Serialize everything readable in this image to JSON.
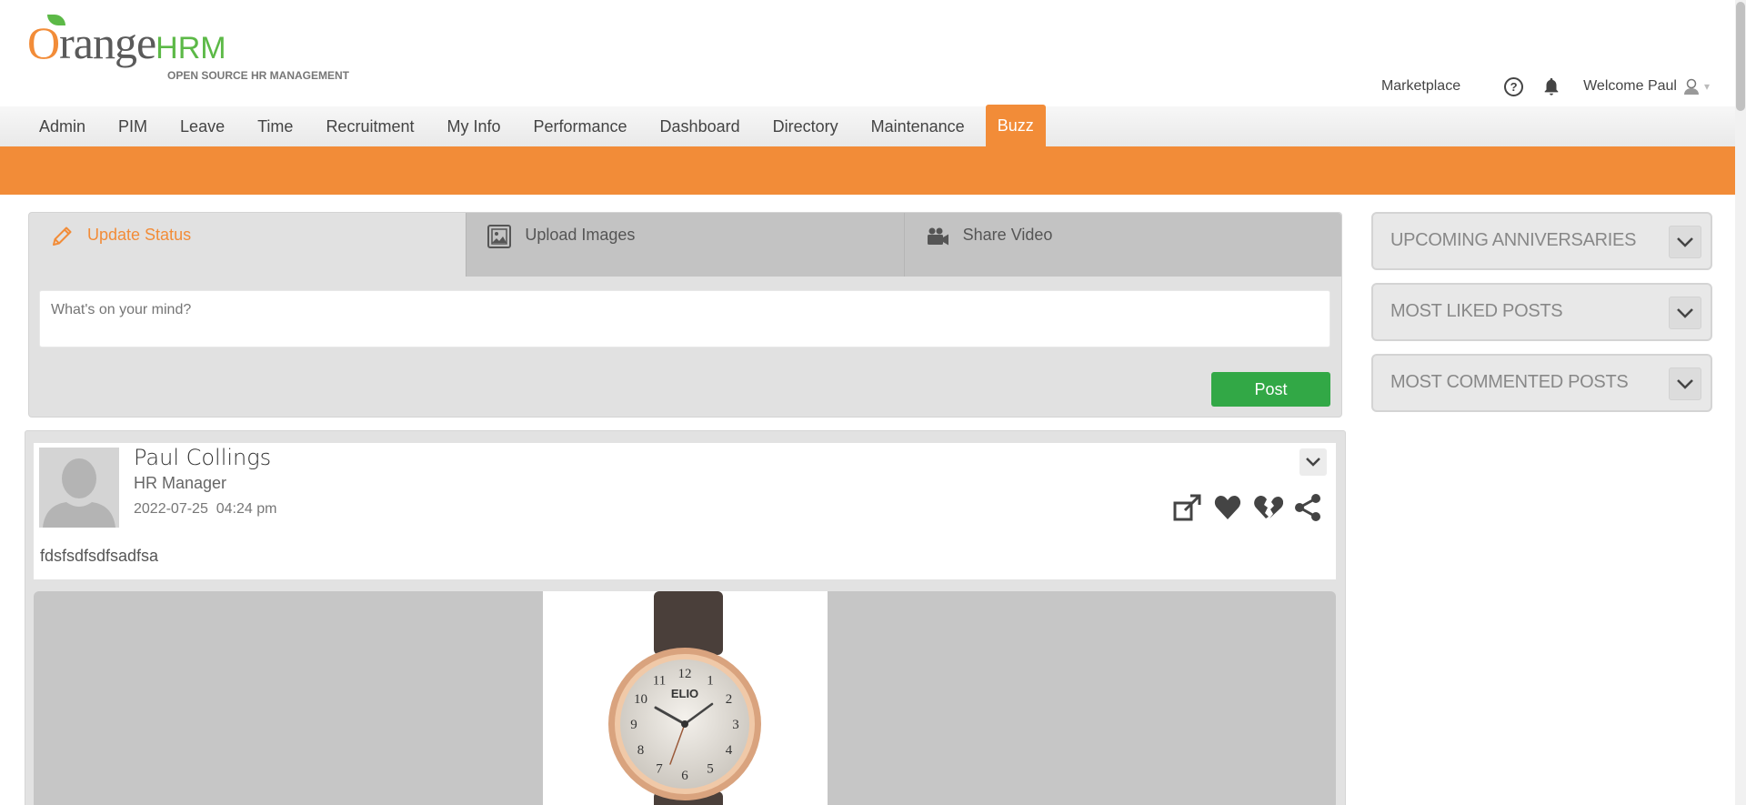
{
  "brand": {
    "name_prefix": "O",
    "name_main": "range",
    "name_suffix": "HRM",
    "tagline": "OPEN SOURCE HR MANAGEMENT"
  },
  "header": {
    "marketplace": "Marketplace",
    "help_symbol": "?",
    "welcome": "Welcome Paul",
    "caret": "▾"
  },
  "menu": {
    "items": [
      "Admin",
      "PIM",
      "Leave",
      "Time",
      "Recruitment",
      "My Info",
      "Performance",
      "Dashboard",
      "Directory",
      "Maintenance",
      "Buzz"
    ],
    "active": "Buzz"
  },
  "status": {
    "tabs": [
      {
        "label": "Update Status",
        "icon": "pencil-icon"
      },
      {
        "label": "Upload Images",
        "icon": "image-icon"
      },
      {
        "label": "Share Video",
        "icon": "video-camera-icon"
      }
    ],
    "placeholder": "What's on your mind?",
    "post_label": "Post"
  },
  "post": {
    "author": "Paul Collings",
    "job_title": "HR Manager",
    "date": "2022-07-25",
    "time": "04:24 pm",
    "text": "fdsfsdfsdfsadfsa",
    "actions": [
      "share-out-icon",
      "heart-icon",
      "broken-heart-icon",
      "share-icon"
    ]
  },
  "widgets": [
    {
      "title": "UPCOMING ANNIVERSARIES"
    },
    {
      "title": "MOST LIKED POSTS"
    },
    {
      "title": "MOST COMMENTED POSTS"
    }
  ],
  "colors": {
    "brand_orange": "#f28c38",
    "brand_green": "#5cb947",
    "post_button": "#32a846"
  },
  "image": {
    "brand": "ELIO",
    "dial_numbers": [
      "12",
      "1",
      "2",
      "3",
      "4",
      "5",
      "6",
      "7",
      "8",
      "9",
      "10",
      "11"
    ]
  }
}
